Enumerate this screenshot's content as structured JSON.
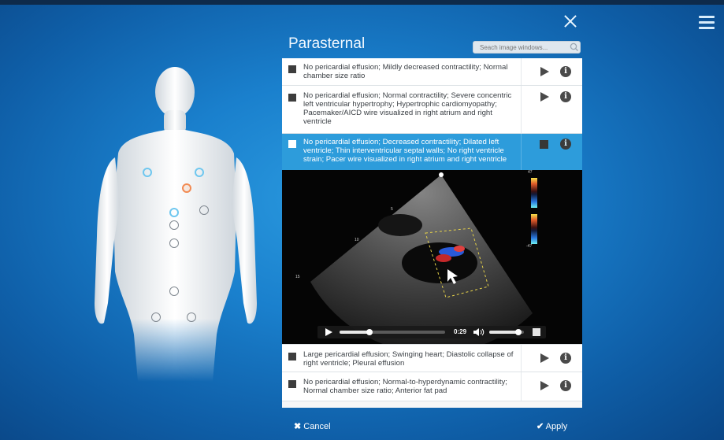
{
  "panel": {
    "title": "Parasternal"
  },
  "search": {
    "placeholder": "Seach image windows..."
  },
  "clips": [
    {
      "label": "No pericardial effusion; Mildly decreased contractility; Normal chamber size ratio"
    },
    {
      "label": "No pericardial effusion; Normal contractility; Severe concentric left ventricular hypertrophy; Hypertrophic cardiomyopathy; Pacemaker/AICD wire visualized in right atrium and right ventricle"
    },
    {
      "label": "No pericardial effusion; Decreased contractility; Dilated left ventricle; Thin interventricular septal walls; No right ventricle strain; Pacer wire visualized in right atrium and right ventricle",
      "selected": true
    },
    {
      "label": "Large pericardial effusion; Swinging heart; Diastolic collapse of right ventricle; Pleural effusion"
    },
    {
      "label": "No pericardial effusion; Normal-to-hyperdynamic contractility; Normal chamber size ratio; Anterior fat pad"
    }
  ],
  "player": {
    "time": "0:29",
    "progress": 0.28,
    "volume": 0.85
  },
  "echo": {
    "depth_labels": [
      "5",
      "10",
      "15"
    ],
    "scale_top": "47",
    "scale_bottom": "-47"
  },
  "footer": {
    "cancel_label": "Cancel",
    "apply_label": "Apply"
  },
  "colors": {
    "accent": "#2d9cdb",
    "background": "#1a80cd",
    "active_marker": "#f28a52",
    "probe_marker": "#6fc7ef"
  },
  "icons": [
    "close-icon",
    "menu-icon",
    "search-icon",
    "play-icon",
    "info-icon",
    "stop-icon",
    "volume-icon",
    "fullscreen-icon",
    "cancel-x-icon",
    "check-icon"
  ]
}
